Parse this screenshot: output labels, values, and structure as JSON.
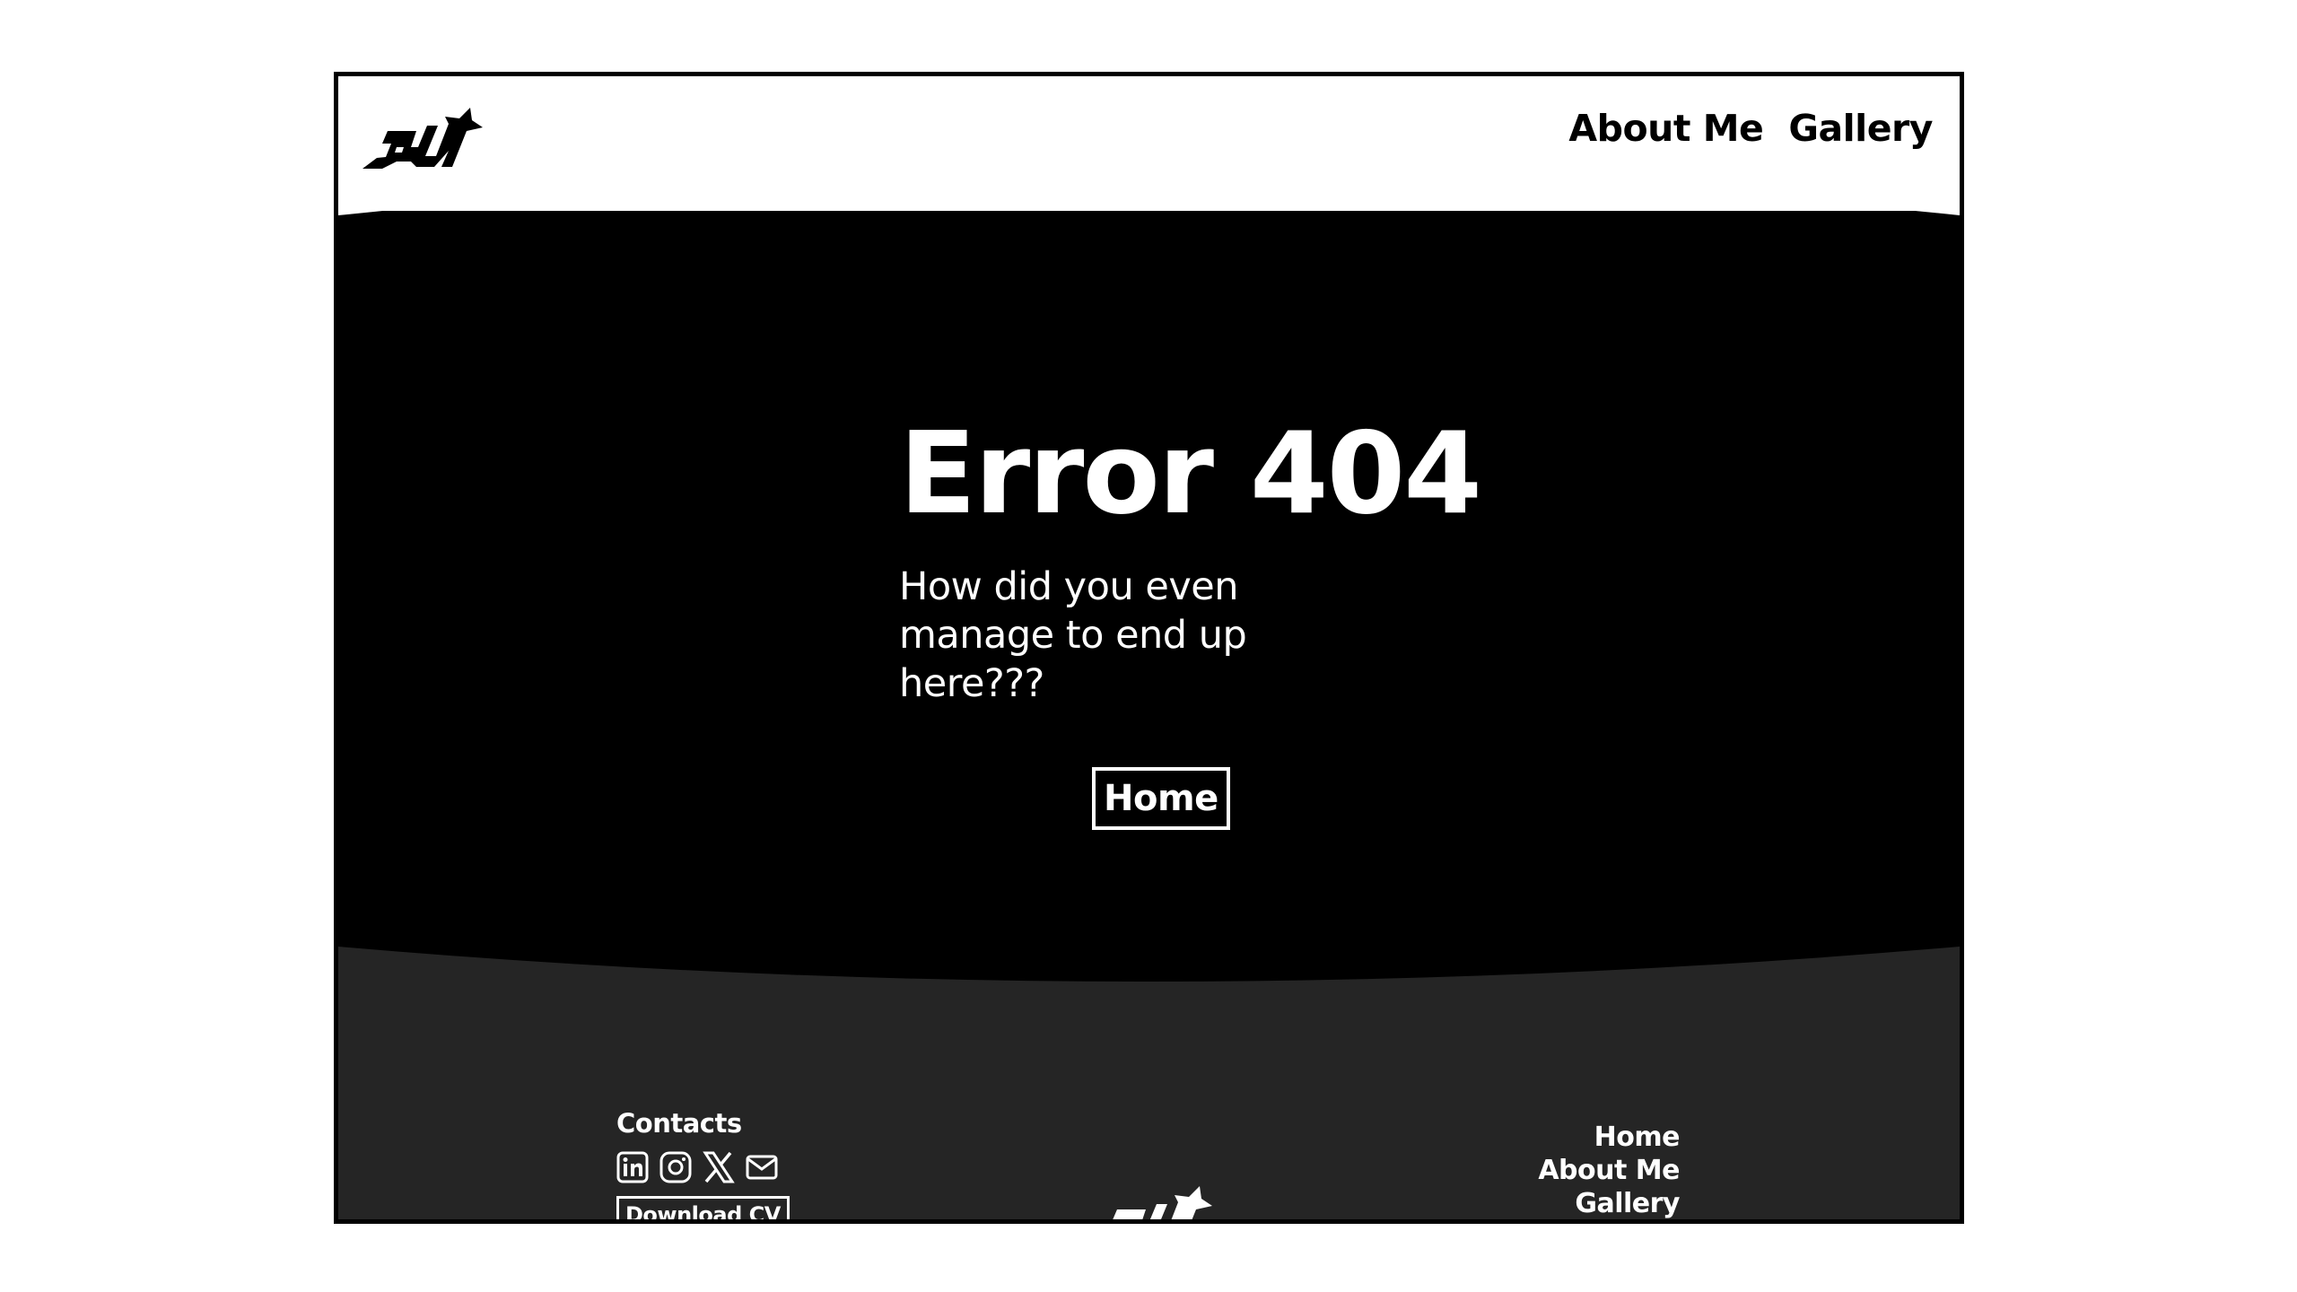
{
  "colors": {
    "page_background": "#ffffff",
    "header_background": "#ffffff",
    "hero_background": "#000000",
    "footer_background": "#252525",
    "text_light": "#ffffff",
    "text_dark": "#000000"
  },
  "header": {
    "logo_icon": "bird-logo-icon",
    "nav": {
      "about": "About Me",
      "gallery": "Gallery"
    }
  },
  "hero": {
    "title": "Error 404",
    "message": "How did you even manage to end up here???",
    "home_button": "Home"
  },
  "footer": {
    "contacts_title": "Contacts",
    "socials": [
      "linkedin-icon",
      "instagram-icon",
      "x-icon",
      "mail-icon"
    ],
    "download_cv": "Download CV",
    "logo_icon": "bird-logo-icon",
    "links": {
      "home": "Home",
      "about": "About Me",
      "gallery": "Gallery"
    }
  }
}
